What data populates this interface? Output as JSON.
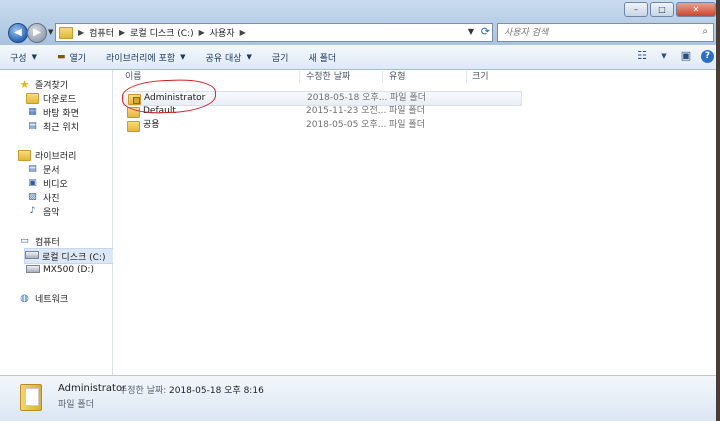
{
  "address": {
    "crumbs": [
      "컴퓨터",
      "로컬 디스크 (C:)",
      "사용자"
    ],
    "search_placeholder": "사용자 검색"
  },
  "window_controls": {
    "minimize": "–",
    "maximize": "□",
    "close": "✕"
  },
  "toolbar": {
    "organize": "구성",
    "open": "열기",
    "include_in_library": "라이브러리에 포함",
    "share_with": "공유 대상",
    "burn": "굽기",
    "new_folder": "새 폴더"
  },
  "nav": {
    "favorites": "즐겨찾기",
    "favorites_items": [
      "다운로드",
      "바탕 화면",
      "최근 위치"
    ],
    "libraries": "라이브러리",
    "library_items": [
      "문서",
      "비디오",
      "사진",
      "음악"
    ],
    "computer": "컴퓨터",
    "computer_items": [
      "로컬 디스크 (C:)",
      "MX500 (D:)"
    ],
    "network": "네트워크"
  },
  "columns": {
    "name": "이름",
    "modified": "수정한 날짜",
    "type": "유형",
    "size": "크기"
  },
  "files": [
    {
      "name": "Administrator",
      "modified": "2018-05-18 오후...",
      "type": "파일 폴더"
    },
    {
      "name": "Default",
      "modified": "2015-11-23 오전...",
      "type": "파일 폴더"
    },
    {
      "name": "공용",
      "modified": "2018-05-05 오후...",
      "type": "파일 폴더"
    }
  ],
  "details": {
    "name": "Administrator",
    "modified_label": "수정한 날짜:",
    "modified_value": "2018-05-18 오후 8:16",
    "type": "파일 폴더"
  },
  "colors": {
    "accent": "#2c67b4",
    "annotation": "#d0202a",
    "selection": "#dde8f6"
  }
}
